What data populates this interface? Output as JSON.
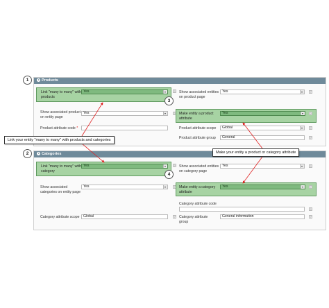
{
  "products": {
    "header": "Products",
    "link_label": "Link \"many to many\" with products",
    "link_value": "Yes",
    "show_assoc_label": "Show associated product on entity page",
    "show_assoc_value": "Yes",
    "attr_code_label": "Product attribute code",
    "show_entities_label": "Show associated entities on product page",
    "show_entities_value": "Yes",
    "make_entity_label": "Make entity a product attribute",
    "make_entity_value": "Yes",
    "attr_scope_label": "Product attribute scope",
    "attr_scope_value": "Global",
    "attr_group_label": "Product attribute group",
    "attr_group_value": "General"
  },
  "categories": {
    "header": "Categories",
    "link_label": "Link \"many to many\" with category",
    "link_value": "Yes",
    "show_assoc_label": "Show associated categories on entity page",
    "show_assoc_value": "Yes",
    "attr_scope_label": "Category attribute scope",
    "attr_scope_value": "Global",
    "show_entities_label": "Show associated entities on category page",
    "show_entities_value": "Yes",
    "make_entity_label": "Make entity a category attribute",
    "make_entity_value": "Yes",
    "attr_code_label": "Category attribute code",
    "attr_group_label": "Category attribute group",
    "attr_group_value": "General information"
  },
  "markers": {
    "m1": "1",
    "m2": "2",
    "m3": "3",
    "m4": "4"
  },
  "callouts": {
    "left": "Link your entity \"many to many\" with products and categories",
    "right": "Make your entity a product or category attribute"
  },
  "help_glyph": "?",
  "required_mark": "*",
  "colors": {
    "header": "#6f8a9a",
    "highlight": "#a7d3a3",
    "highlight_select": "#7fba7f",
    "arrow": "#e02020"
  }
}
